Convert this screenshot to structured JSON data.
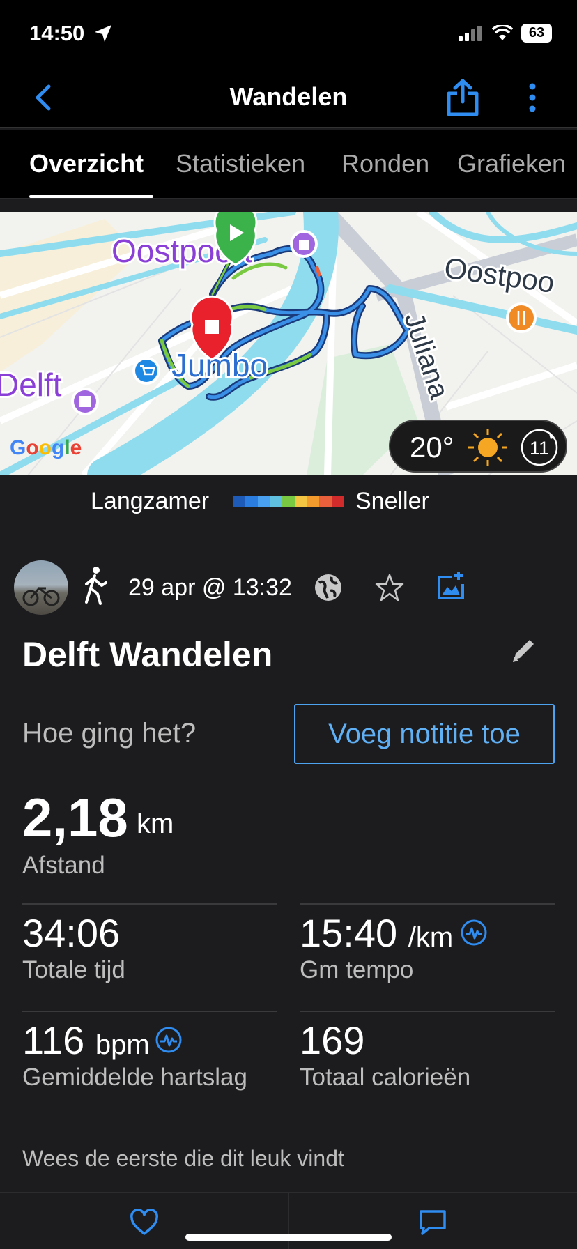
{
  "status": {
    "time": "14:50",
    "battery": "63"
  },
  "nav": {
    "title": "Wandelen"
  },
  "tabs": [
    {
      "label": "Overzicht",
      "active": true
    },
    {
      "label": "Statistieken",
      "active": false
    },
    {
      "label": "Ronden",
      "active": false
    },
    {
      "label": "Grafieken",
      "active": false
    }
  ],
  "map": {
    "labels": {
      "oostpoort": "Oostpoort",
      "oostpoort_right": "Oostpoo",
      "jumbo": "Jumbo",
      "delft": "Delft",
      "juliana": "Juliana"
    },
    "weather": {
      "temperature": "20°",
      "wind": "11"
    },
    "attribution": "Google"
  },
  "legend": {
    "slow": "Langzamer",
    "fast": "Sneller",
    "colors": [
      "#1e5bb8",
      "#2b7de0",
      "#4aa0f0",
      "#5fc0e0",
      "#7ac943",
      "#f4c542",
      "#f39c2d",
      "#e8603c",
      "#d22b2b"
    ]
  },
  "activity": {
    "date": "29 apr @ 13:32",
    "title": "Delft Wandelen",
    "feel_prompt": "Hoe ging het?",
    "add_note": "Voeg notitie toe"
  },
  "stats": {
    "distance": {
      "value": "2,18",
      "unit": "km",
      "label": "Afstand"
    },
    "total_time": {
      "value": "34:06",
      "label": "Totale tijd"
    },
    "avg_pace": {
      "value": "15:40",
      "unit": "/km",
      "label": "Gm tempo"
    },
    "avg_hr": {
      "value": "116",
      "unit": "bpm",
      "label": "Gemiddelde hartslag"
    },
    "calories": {
      "value": "169",
      "label": "Totaal calorieën"
    }
  },
  "social": {
    "likes_text": "Wees de eerste die dit leuk vindt"
  }
}
